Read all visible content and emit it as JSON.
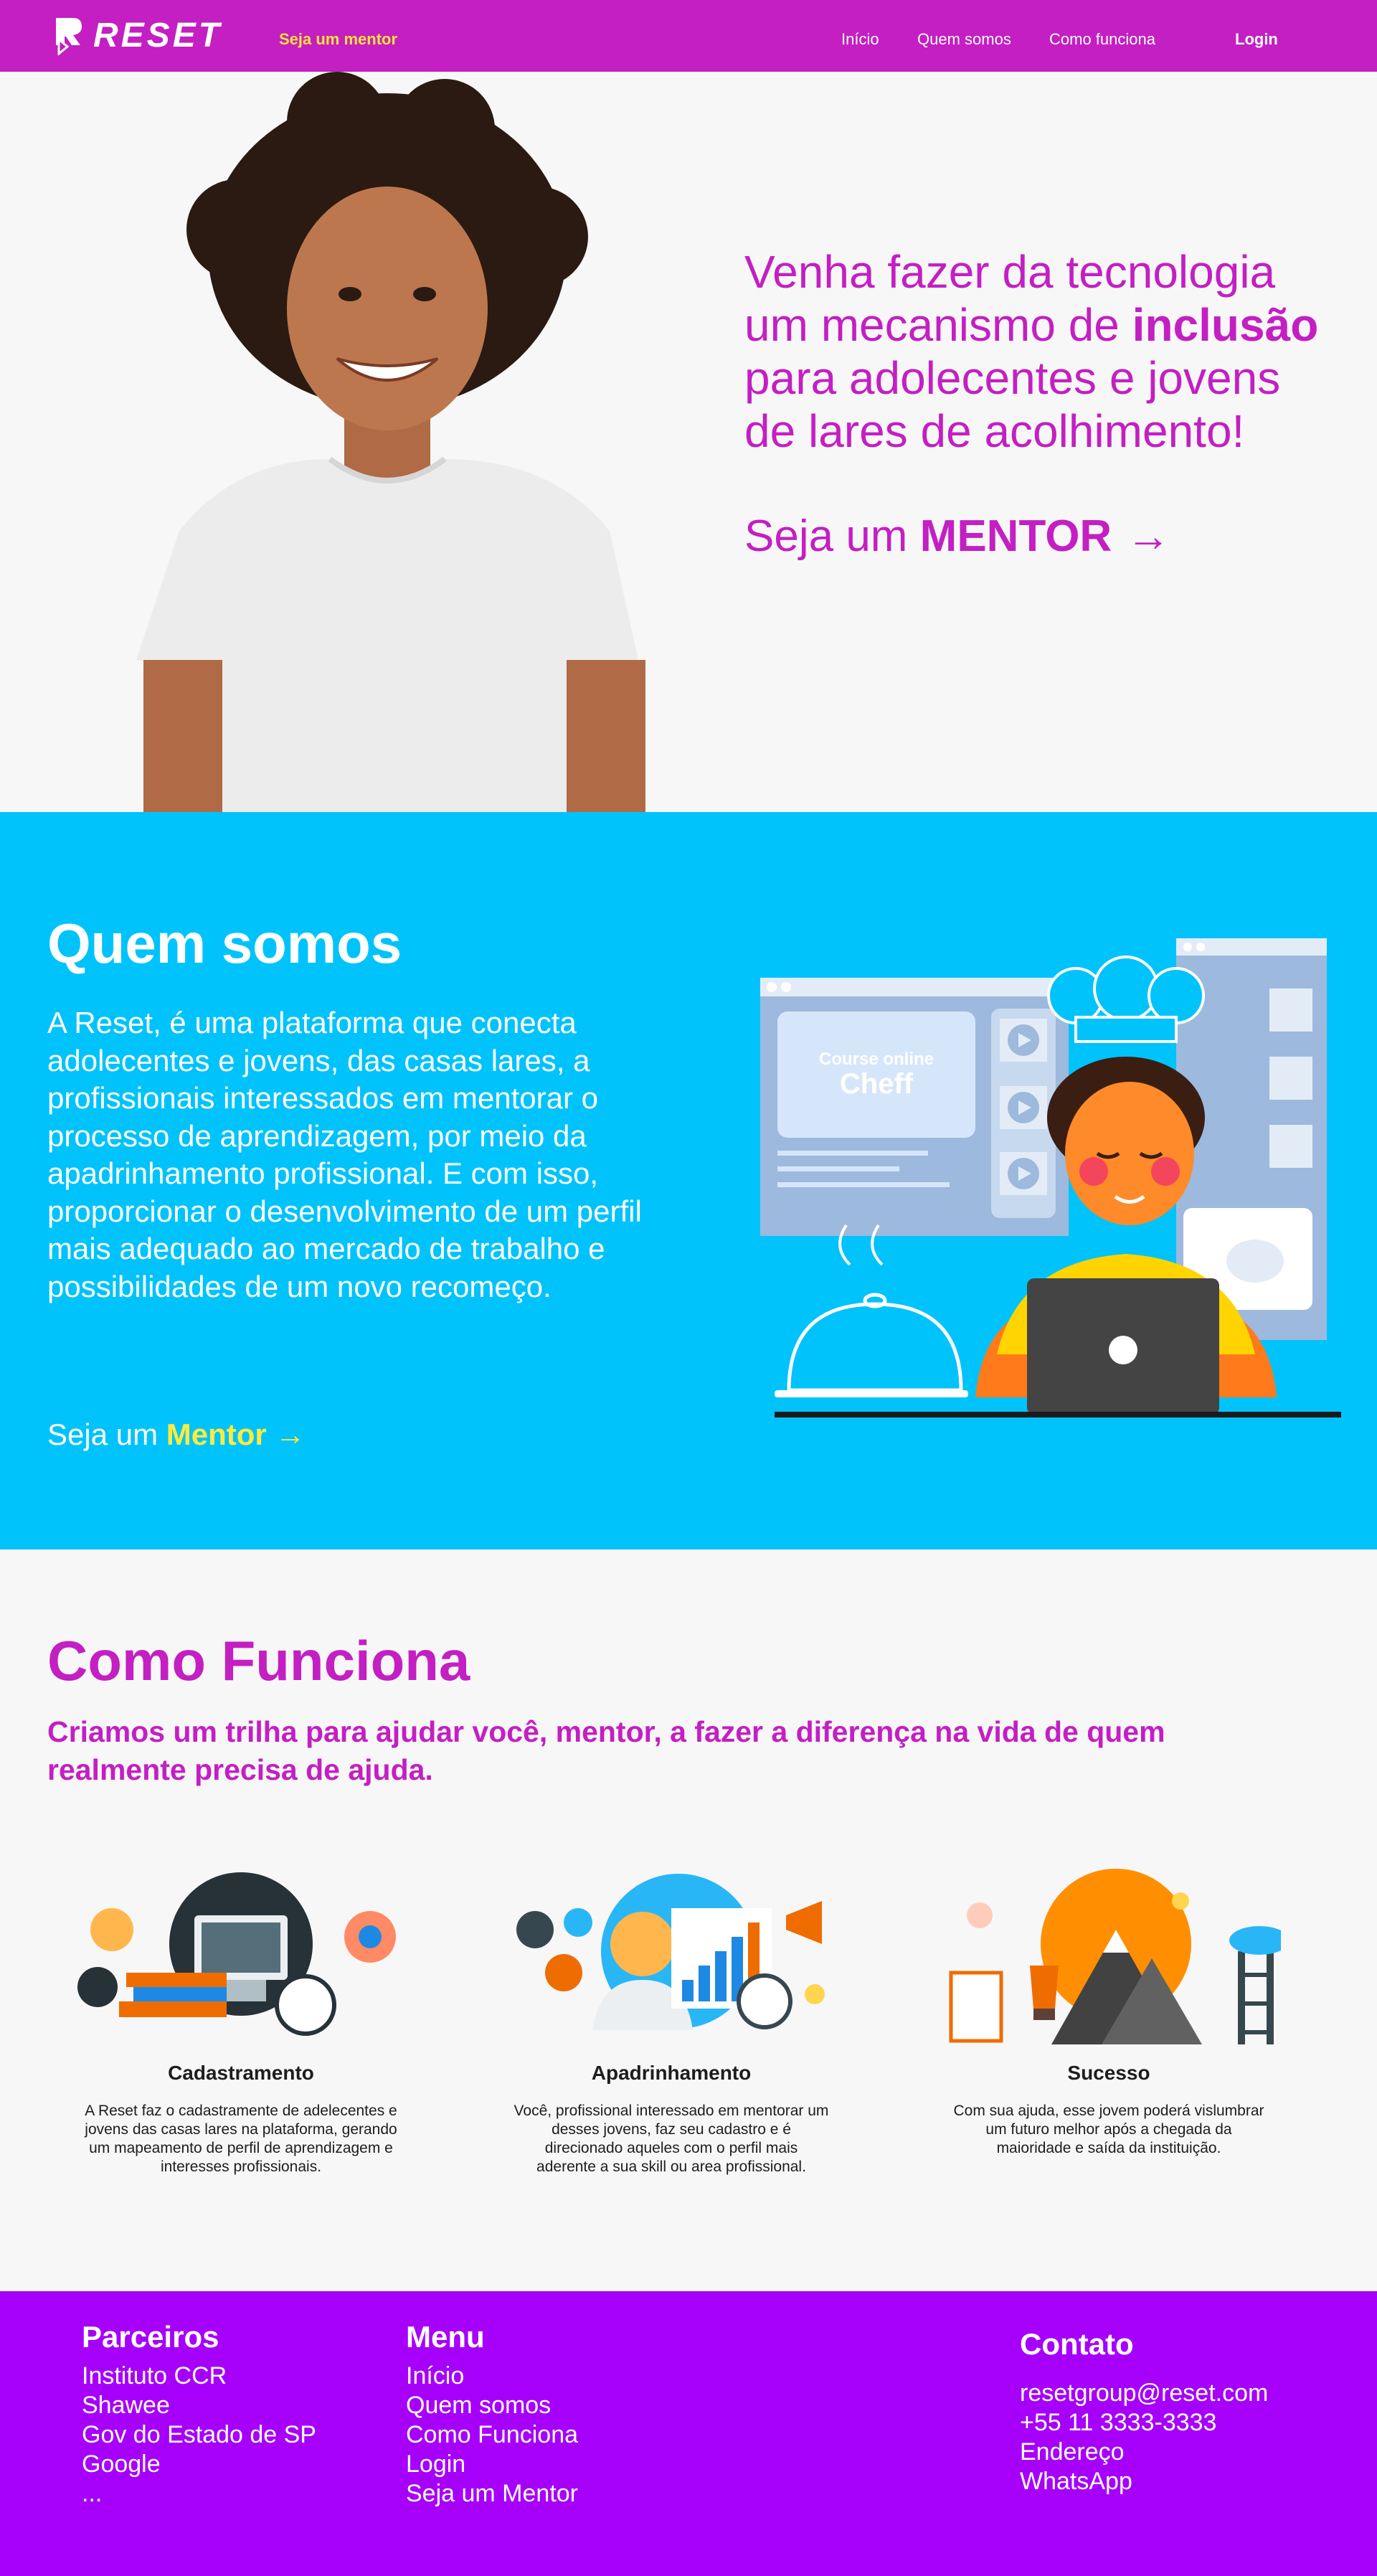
{
  "nav": {
    "logo_text": "RESET",
    "mentor_link": "Seja um mentor",
    "links": [
      "Início",
      "Quem somos",
      "Como funciona"
    ],
    "login": "Login"
  },
  "hero": {
    "headline_pre": "Venha fazer da tecnologia um mecanismo de ",
    "headline_bold": "inclusão",
    "headline_post": " para adolecentes e jovens de lares de acolhimento!",
    "cta_pre": "Seja um ",
    "cta_bold": "MENTOR",
    "cta_arrow": "→"
  },
  "about": {
    "title": "Quem somos",
    "text": "A Reset, é uma plataforma que conecta adolecentes e jovens, das casas lares, a profissionais interessados em mentorar o processo de aprendizagem, por meio da apadrinhamento profissional. E com isso, proporcionar o desenvolvimento de um perfil mais adequado ao mercado de trabalho e possibilidades de um novo recomeço.",
    "cta_pre": "Seja um ",
    "cta_bold": "Mentor",
    "cta_arrow": "→",
    "illus_card_line1": "Course online",
    "illus_card_line2": "Cheff"
  },
  "how": {
    "title": "Como Funciona",
    "subtitle": "Criamos um trilha para ajudar você, mentor, a fazer a diferença na vida de quem realmente precisa de ajuda.",
    "steps": [
      {
        "title": "Cadastramento",
        "text": "A Reset faz o cadastramente de adelecentes e jovens das casas lares na plataforma, gerando um mapeamento de perfil de aprendizagem e interesses profissionais."
      },
      {
        "title": "Apadrinhamento",
        "text": "Você, profissional interessado em mentorar um desses jovens, faz seu cadastro e é direcionado aqueles com o perfil mais aderente a sua skill ou area profissional."
      },
      {
        "title": "Sucesso",
        "text": "Com sua ajuda, esse jovem poderá vislumbrar um futuro melhor após a chegada da maioridade e saída da instituição."
      }
    ]
  },
  "footer": {
    "partners_title": "Parceiros",
    "partners": [
      "Instituto CCR",
      "Shawee",
      "Gov do Estado de SP",
      "Google",
      "..."
    ],
    "menu_title": "Menu",
    "menu": [
      "Início",
      "Quem somos",
      "Como Funciona",
      "Login",
      "Seja um Mentor"
    ],
    "contact_title": "Contato",
    "contact": [
      "resetgroup@reset.com",
      "+55 11 3333-3333",
      "Endereço",
      "WhatsApp"
    ]
  },
  "colors": {
    "brand_magenta": "#c31fc3",
    "about_blue": "#00c3fb",
    "footer_purple": "#a600fa",
    "accent_yellow": "#ffeb3b"
  }
}
